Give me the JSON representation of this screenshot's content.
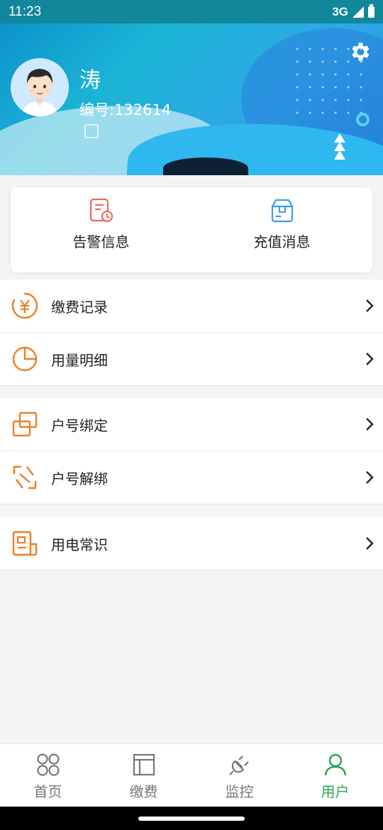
{
  "status_bar": {
    "time": "11:23",
    "network": "3G"
  },
  "profile": {
    "name": "涛",
    "id_text": "编号:132614"
  },
  "quick_actions": [
    {
      "label": "告警信息",
      "icon": "alarm-document-icon",
      "color": "#f0685c"
    },
    {
      "label": "充值消息",
      "icon": "recharge-box-icon",
      "color": "#3d9be9"
    }
  ],
  "menu_groups": [
    [
      {
        "label": "缴费记录",
        "icon": "yuan-circle-icon"
      },
      {
        "label": "用量明细",
        "icon": "pie-chart-icon"
      }
    ],
    [
      {
        "label": "户号绑定",
        "icon": "link-icon"
      },
      {
        "label": "户号解绑",
        "icon": "unlink-icon"
      }
    ],
    [
      {
        "label": "用电常识",
        "icon": "newspaper-icon"
      }
    ]
  ],
  "bottom_nav": [
    {
      "label": "首页",
      "icon": "home-grid-icon",
      "active": false
    },
    {
      "label": "缴费",
      "icon": "payment-icon",
      "active": false
    },
    {
      "label": "监控",
      "icon": "plug-icon",
      "active": false
    },
    {
      "label": "用户",
      "icon": "user-icon",
      "active": true
    }
  ],
  "colors": {
    "accent_orange": "#ee7d22",
    "active_green": "#23a84a",
    "header_blue": "#1cb4d6"
  }
}
